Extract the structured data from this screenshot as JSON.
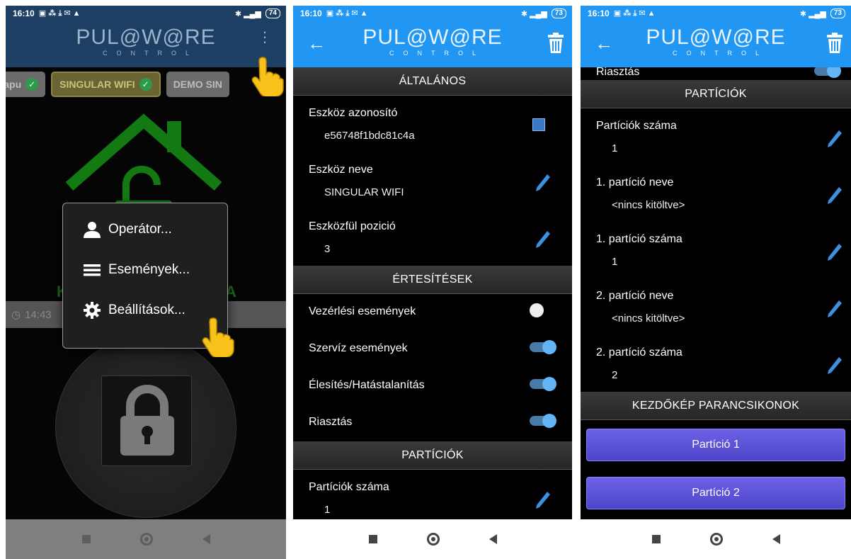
{
  "status": {
    "time": "16:10",
    "battery_p1": "74",
    "battery_p2": "73",
    "battery_p3": "73"
  },
  "app": {
    "logo_main": "PUL@W@RE",
    "logo_sub": "CONTROL"
  },
  "phone1": {
    "tabs": [
      {
        "label": "ay kapu"
      },
      {
        "label": "SINGULAR WIFI"
      },
      {
        "label": "DEMO SIN"
      }
    ],
    "menu": [
      {
        "label": "Operátor...",
        "icon": "person-icon"
      },
      {
        "label": "Események...",
        "icon": "list-icon"
      },
      {
        "label": "Beállítások...",
        "icon": "gear-icon"
      }
    ],
    "time_partial": "14:43",
    "green_left": "K",
    "green_right": "A"
  },
  "phone2": {
    "section_general": "ÁLTALÁNOS",
    "device_id_label": "Eszköz azonosító",
    "device_id_value": "e56748f1bdc81c4a",
    "device_name_label": "Eszköz neve",
    "device_name_value": "SINGULAR WIFI",
    "tab_position_label": "Eszközfül pozició",
    "tab_position_value": "3",
    "section_notifications": "ÉRTESÍTÉSEK",
    "toggles": [
      {
        "label": "Vezérlési események",
        "on": false
      },
      {
        "label": "Szervíz események",
        "on": true
      },
      {
        "label": "Élesítés/Hatástalanítás",
        "on": true
      },
      {
        "label": "Riasztás",
        "on": true
      }
    ],
    "section_partitions": "PARTÍCIÓK",
    "partition_count_label": "Partíciók száma",
    "partition_count_value": "1"
  },
  "phone3": {
    "top_partial_label": "Riasztás",
    "section_partitions": "PARTÍCIÓK",
    "rows": [
      {
        "label": "Partíciók száma",
        "value": "1"
      },
      {
        "label": "1. partíció neve",
        "value": "<nincs kitöltve>"
      },
      {
        "label": "1. partíció száma",
        "value": "1"
      },
      {
        "label": "2. partíció neve",
        "value": "<nincs kitöltve>"
      },
      {
        "label": "2. partíció száma",
        "value": "2"
      }
    ],
    "section_start_icons": "KEZDŐKÉP PARANCSIKONOK",
    "buttons": [
      {
        "label": "Partíció 1"
      },
      {
        "label": "Partíció 2"
      }
    ]
  },
  "colors": {
    "appbar": "#2196f3",
    "toggle_on": "#64b5f6",
    "partition_button": "#5a52d8"
  }
}
